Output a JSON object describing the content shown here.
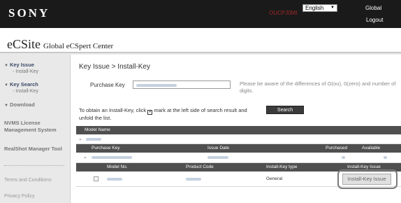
{
  "header": {
    "brand": "SONY",
    "user_id": "OUCPJ0MI",
    "language": "English",
    "global_label": "Global",
    "logout_label": "Logout"
  },
  "app": {
    "title_big": "eCSite",
    "title_small": "Global eCSpert Center"
  },
  "sidebar": {
    "key_issue": "Key Issue",
    "install_key_1": "- Install-Key",
    "key_search": "Key Search",
    "install_key_2": "- Install-Key",
    "download": "Download",
    "nvms": "NVMS License Management System",
    "realshot": "RealShot Manager Tool",
    "terms": "Terms and Conditions",
    "privacy": "Privacy Policy"
  },
  "main": {
    "breadcrumb": "Key Issue > Install-Key",
    "purchase_key_label": "Purchase Key",
    "purchase_key_value": "",
    "note": "Please be aware of the differences of O(ou), 0(zero) and number of digits.",
    "instruction_before": "To obtain an Install-Key, click ",
    "instruction_after": " mark at the left side of search result and unfold the list.",
    "search_label": "Search"
  },
  "table": {
    "model_name_header": "Model Name",
    "purchase_key_header": "Purchase Key",
    "issue_date_header": "Issue Date",
    "purchased_header": "Purchased",
    "available_header": "Available",
    "model_no_header": "Model No.",
    "product_code_header": "Product Code",
    "install_key_type_header": "Install-Key type",
    "install_key_issue_header": "Install-Key Issue",
    "row_type": "General",
    "issue_button": "Install-Key Issue"
  }
}
